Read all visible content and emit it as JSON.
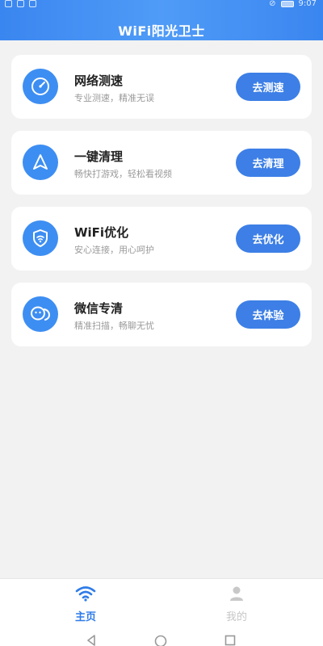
{
  "status": {
    "time": "9:07"
  },
  "app": {
    "title": "WiFi阳光卫士"
  },
  "cards": [
    {
      "title": "网络测速",
      "subtitle": "专业测速，精准无误",
      "button": "去测速",
      "icon": "speedometer-icon"
    },
    {
      "title": "一键清理",
      "subtitle": "畅快打游戏，轻松看视频",
      "button": "去清理",
      "icon": "navigation-arrow-icon"
    },
    {
      "title": "WiFi优化",
      "subtitle": "安心连接，用心呵护",
      "button": "去优化",
      "icon": "shield-wifi-icon"
    },
    {
      "title": "微信专清",
      "subtitle": "精准扫描，畅聊无忧",
      "button": "去体验",
      "icon": "wechat-icon"
    }
  ],
  "tabs": [
    {
      "label": "主页",
      "icon": "wifi-icon",
      "active": true
    },
    {
      "label": "我的",
      "icon": "person-icon",
      "active": false
    }
  ],
  "colors": {
    "accent": "#3d7fe6",
    "header": "#4a92f5",
    "background": "#f2f2f2"
  }
}
